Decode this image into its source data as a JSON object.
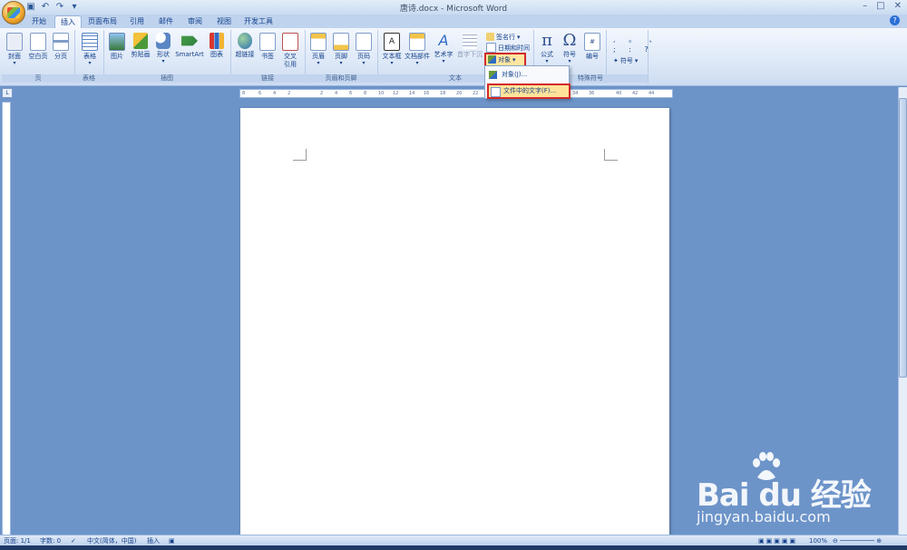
{
  "window": {
    "title": "唐诗.docx - Microsoft Word",
    "controls": [
      "minimize",
      "maximize",
      "close"
    ]
  },
  "quick_access": [
    "save-icon",
    "undo-icon",
    "redo-icon",
    "customize-icon"
  ],
  "tabs": [
    "开始",
    "插入",
    "页面布局",
    "引用",
    "邮件",
    "审阅",
    "视图",
    "开发工具"
  ],
  "active_tab": "插入",
  "ribbon": {
    "groups": {
      "pages": "页",
      "tables": "表格",
      "illustrations": "插图",
      "links": "链接",
      "header_footer": "页眉和页脚",
      "text": "文本",
      "special_symbols": "特殊符号"
    },
    "buttons": {
      "cover": "封面",
      "blank_page": "空白页",
      "page_break": "分页",
      "table": "表格",
      "picture": "图片",
      "clip_art": "剪贴画",
      "shapes": "形状",
      "smartart": "SmartArt",
      "chart": "图表",
      "hyperlink": "超链接",
      "bookmark": "书签",
      "cross_ref_1": "交叉",
      "cross_ref_2": "引用",
      "header": "页眉",
      "footer": "页脚",
      "page_number": "页码",
      "text_box": "文本框",
      "quick_parts": "文档部件",
      "wordart": "艺术字",
      "drop_cap": "首字下沉",
      "signature_line": "签名行",
      "date_time": "日期和时间",
      "object": "对象",
      "equation": "公式",
      "symbol": "符号",
      "numbering": "编号",
      "special_symbol": "符号"
    }
  },
  "object_menu": {
    "items": [
      "对象(J)...",
      "文件中的文字(F)..."
    ]
  },
  "ruler": {
    "left_ticks": [
      "8",
      "6",
      "4",
      "2"
    ],
    "right_ticks": [
      "2",
      "4",
      "6",
      "8",
      "10",
      "12",
      "14",
      "16",
      "18",
      "20",
      "22",
      "34",
      "36",
      "40",
      "42",
      "44"
    ]
  },
  "status_bar": {
    "page": "页面: 1/1",
    "words": "字数: 0",
    "language": "中文(简体，中国)",
    "mode": "插入",
    "zoom": "100%"
  },
  "watermark": {
    "brand": "Bai du 经验",
    "url": "jingyan.baidu.com"
  },
  "colors": {
    "accent_red": "#d2292a",
    "ribbon_bg": "#dde8f7",
    "doc_bg": "#6d94c9"
  }
}
